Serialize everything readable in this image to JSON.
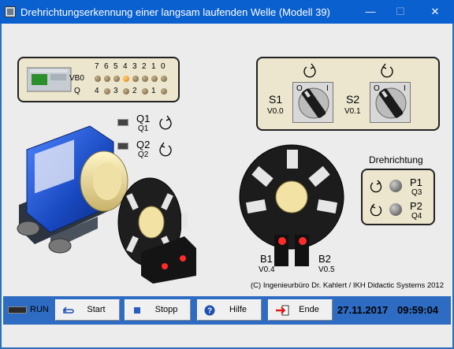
{
  "window": {
    "title": "Drehrichtungserkennung einer langsam laufenden Welle (Modell 39)",
    "minimize_label": "—",
    "maximize_label": "☐",
    "close_label": "✕"
  },
  "plc": {
    "bit_numbers": [
      "7",
      "6",
      "5",
      "4",
      "3",
      "2",
      "1",
      "0"
    ],
    "vb0_label": "VB0",
    "vb0_leds": [
      false,
      false,
      false,
      true,
      false,
      false,
      false,
      false
    ],
    "q_label": "Q",
    "q_numbers": [
      "4",
      "3",
      "2",
      "1"
    ]
  },
  "outputs": {
    "q1_label": "Q1",
    "q1_sub": "Q1",
    "q2_label": "Q2",
    "q2_sub": "Q2"
  },
  "switches": {
    "s1_label": "S1",
    "s1_sub": "V0.0",
    "s2_label": "S2",
    "s2_sub": "V0.1",
    "switch_o": "O",
    "switch_i": "I"
  },
  "direction": {
    "title": "Drehrichtung",
    "p1_label": "P1",
    "p1_sub": "Q3",
    "p2_label": "P2",
    "p2_sub": "Q4"
  },
  "sensors": {
    "b1_label": "B1",
    "b1_sub": "V0.4",
    "b2_label": "B2",
    "b2_sub": "V0.5"
  },
  "copyright": "(C) Ingenieurbüro Dr. Kahlert / IKH Didactic Systems 2012",
  "toolbar": {
    "run_label": "RUN",
    "start_label": "Start",
    "stop_label": "Stopp",
    "help_label": "Hilfe",
    "end_label": "Ende",
    "date": "27.11.2017",
    "time": "09:59:04"
  },
  "colors": {
    "title_bar": "#0a60cf",
    "panel": "#ebe6cd",
    "motor_blue": "#1a50c8",
    "led_on": "#e07a00"
  }
}
